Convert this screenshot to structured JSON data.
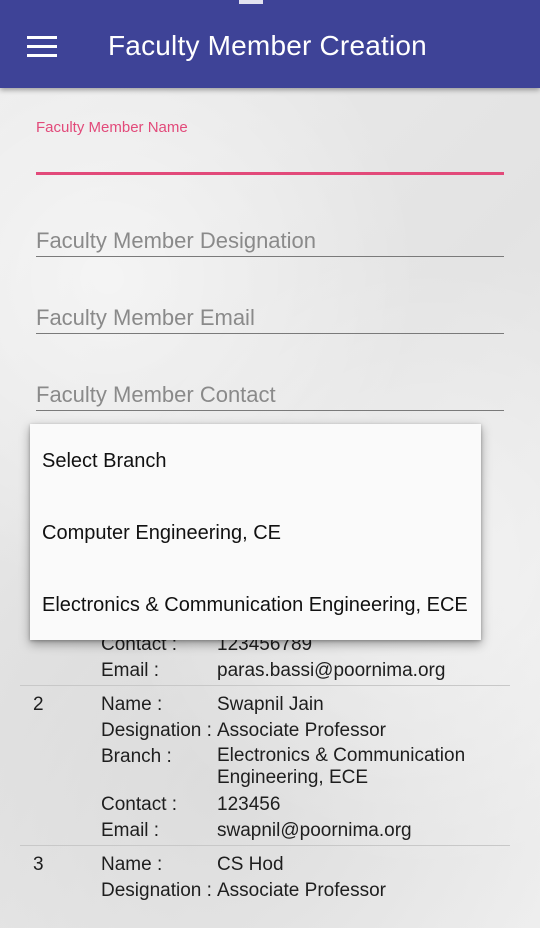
{
  "appbar": {
    "title": "Faculty Member Creation"
  },
  "form": {
    "name": {
      "label": "Faculty Member Name",
      "value": ""
    },
    "designation": {
      "placeholder": "Faculty Member Designation"
    },
    "email": {
      "placeholder": "Faculty Member Email"
    },
    "contact": {
      "placeholder": "Faculty Member Contact"
    }
  },
  "dropdown": {
    "options": [
      "Select Branch",
      "Computer Engineering, CE",
      "Electronics & Communication Engineering, ECE"
    ]
  },
  "labels": {
    "name": "Name :",
    "designation": "Designation :",
    "branch": "Branch :",
    "contact": "Contact :",
    "email": "Email :"
  },
  "faculty": [
    {
      "contact": "123456789",
      "email": "paras.bassi@poornima.org"
    },
    {
      "index": "2",
      "name": "Swapnil Jain",
      "designation": "Associate Professor",
      "branch": "Electronics & Communication Engineering, ECE",
      "contact": "123456",
      "email": "swapnil@poornima.org"
    },
    {
      "index": "3",
      "name": "CS Hod",
      "designation": "Associate Professor"
    }
  ]
}
